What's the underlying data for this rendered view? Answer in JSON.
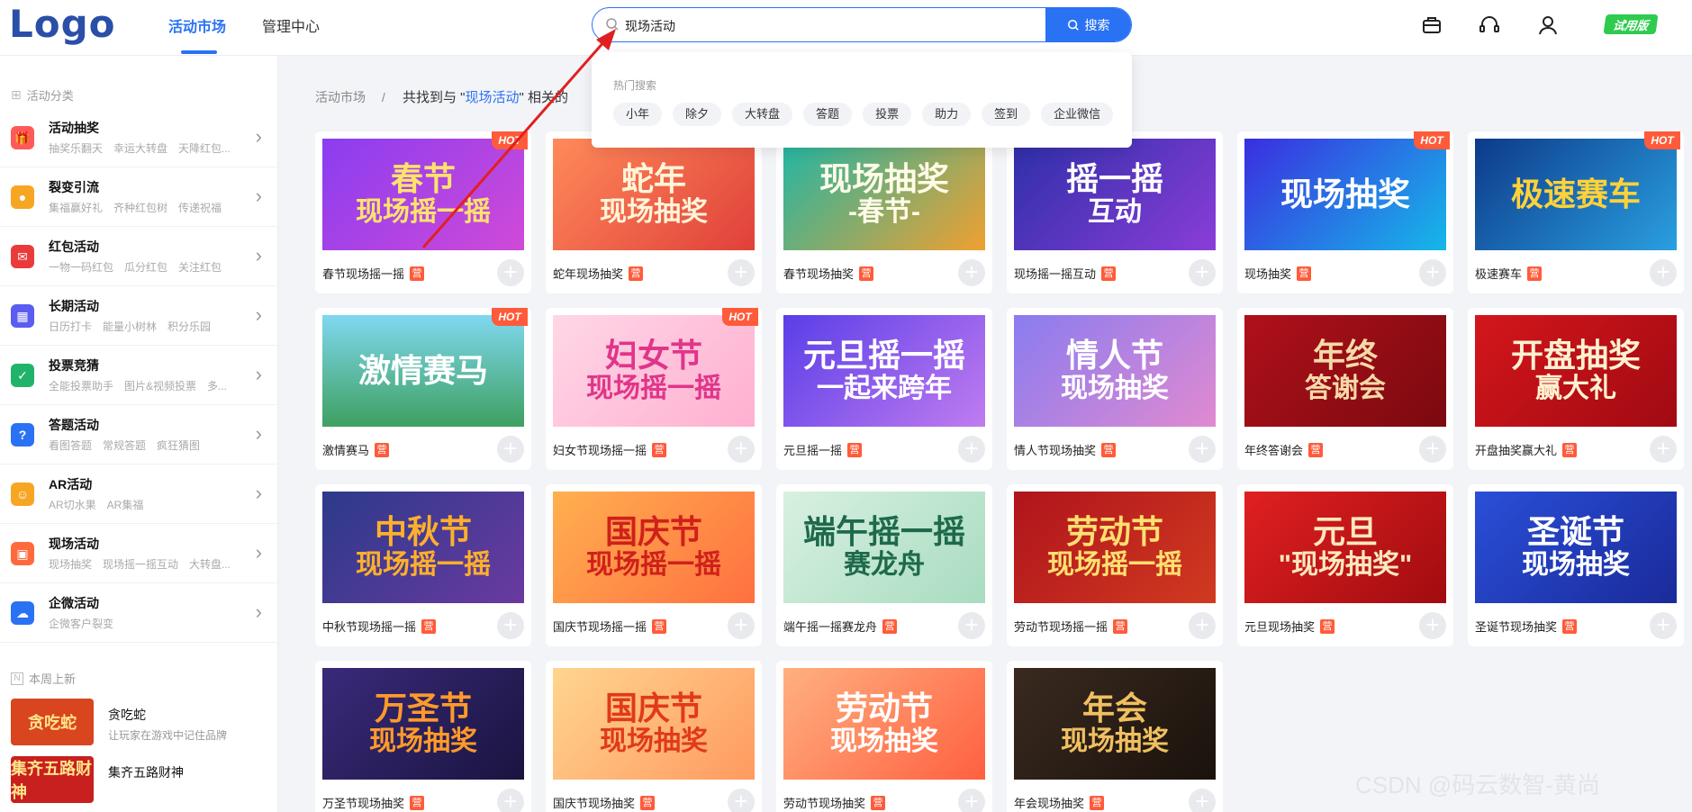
{
  "header": {
    "logo": "Logo",
    "nav": [
      {
        "label": "活动市场",
        "active": true
      },
      {
        "label": "管理中心",
        "active": false
      }
    ],
    "search": {
      "value": "现场活动",
      "button": "搜索"
    },
    "trial_label": "试用版",
    "icons": [
      "toolbox-icon",
      "headset-icon",
      "user-icon"
    ]
  },
  "sidebar": {
    "section_title": "活动分类",
    "categories": [
      {
        "title": "活动抽奖",
        "sub": "抽奖乐翻天　幸运大转盘　天降红包...",
        "icon": "gift-icon",
        "color": "#ff5a5a",
        "glyph": "🎁"
      },
      {
        "title": "裂变引流",
        "sub": "集福赢好礼　齐种红包树　传递祝福",
        "icon": "people-icon",
        "color": "#f7a623",
        "glyph": "●"
      },
      {
        "title": "红包活动",
        "sub": "一物一码红包　瓜分红包　关注红包",
        "icon": "red-envelope-icon",
        "color": "#ea3b3b",
        "glyph": "✉"
      },
      {
        "title": "长期活动",
        "sub": "日历打卡　能量小树林　积分乐园",
        "icon": "calendar-icon",
        "color": "#5b5cf0",
        "glyph": "▦"
      },
      {
        "title": "投票竞猜",
        "sub": "全能投票助手　图片&视频投票　多...",
        "icon": "vote-icon",
        "color": "#22b36b",
        "glyph": "✓"
      },
      {
        "title": "答题活动",
        "sub": "看图答题　常规答题　疯狂猜图",
        "icon": "question-icon",
        "color": "#2a72f4",
        "glyph": "?"
      },
      {
        "title": "AR活动",
        "sub": "AR切水果　AR集福",
        "icon": "robot-icon",
        "color": "#f7a623",
        "glyph": "☺"
      },
      {
        "title": "现场活动",
        "sub": "现场抽奖　现场摇一摇互动　大转盘...",
        "icon": "stage-icon",
        "color": "#ff6a3d",
        "glyph": "▣"
      },
      {
        "title": "企微活动",
        "sub": "企微客户裂变",
        "icon": "wecom-icon",
        "color": "#2a72f4",
        "glyph": "☁"
      }
    ],
    "new_title": "本周上新",
    "new_items": [
      {
        "title": "贪吃蛇",
        "sub": "让玩家在游戏中记住品牌",
        "thumb": "贪吃蛇",
        "color": "#d9451f"
      },
      {
        "title": "集齐五路财神",
        "sub": "",
        "thumb": "集齐五路财神",
        "color": "#c8201e"
      }
    ]
  },
  "breadcrumb": {
    "root": "活动市场",
    "separator": "/",
    "prefix": "共找到与 \"",
    "keyword": "现场活动",
    "suffix": "\" 相关的"
  },
  "dropdown": {
    "title": "热门搜索",
    "tags": [
      "小年",
      "除夕",
      "大转盘",
      "答题",
      "投票",
      "助力",
      "签到",
      "企业微信"
    ]
  },
  "badge_label": "营",
  "hot_label": "HOT",
  "cards": [
    {
      "name": "春节现场摇一摇",
      "line1": "春节",
      "line2": "现场摇一摇",
      "bg": "linear-gradient(135deg,#8a3df0,#d04ad8)",
      "fg": "#ffe36b",
      "hot": true
    },
    {
      "name": "蛇年现场抽奖",
      "line1": "蛇年",
      "line2": "现场抽奖",
      "bg": "linear-gradient(135deg,#ff8a5a,#e0403a)",
      "fg": "#fff5d8",
      "hot": false
    },
    {
      "name": "春节现场抽奖",
      "line1": "现场抽奖",
      "line2": "-春节-",
      "bg": "linear-gradient(135deg,#1fb6a6,#f0a030)",
      "fg": "#fffbe8",
      "hot": false
    },
    {
      "name": "现场摇一摇互动",
      "line1": "摇一摇",
      "line2": "互动",
      "bg": "linear-gradient(135deg,#2d2fa8,#8b3dd8)",
      "fg": "#ffffff",
      "hot": false
    },
    {
      "name": "现场抽奖",
      "line1": "现场抽奖",
      "line2": "",
      "bg": "linear-gradient(135deg,#3a2ee0,#16b8e8)",
      "fg": "#ffffff",
      "hot": true
    },
    {
      "name": "极速赛车",
      "line1": "极速赛车",
      "line2": "",
      "bg": "linear-gradient(135deg,#0d3a8a,#2aa0e0)",
      "fg": "#ffd23a",
      "hot": true
    },
    {
      "name": "激情赛马",
      "line1": "激情赛马",
      "line2": "",
      "bg": "linear-gradient(180deg,#7fd8f0,#3ea060)",
      "fg": "#ffffff",
      "hot": true
    },
    {
      "name": "妇女节现场摇一摇",
      "line1": "妇女节",
      "line2": "现场摇一摇",
      "bg": "linear-gradient(135deg,#ffd6e6,#ffb0d0)",
      "fg": "#e0358a",
      "hot": true
    },
    {
      "name": "元旦摇一摇",
      "line1": "元旦摇一摇",
      "line2": "一起来跨年",
      "bg": "linear-gradient(135deg,#5a3ee8,#c07cf0)",
      "fg": "#ffffff",
      "hot": false
    },
    {
      "name": "情人节现场抽奖",
      "line1": "情人节",
      "line2": "现场抽奖",
      "bg": "linear-gradient(135deg,#8a7cf0,#e08ad0)",
      "fg": "#ffffff",
      "hot": false
    },
    {
      "name": "年终答谢会",
      "line1": "年终",
      "line2": "答谢会",
      "bg": "linear-gradient(135deg,#b0101a,#7a0a10)",
      "fg": "#f5d9a8",
      "hot": false
    },
    {
      "name": "开盘抽奖赢大礼",
      "line1": "开盘抽奖",
      "line2": "赢大礼",
      "bg": "linear-gradient(135deg,#d4161c,#a00a12)",
      "fg": "#fff1d0",
      "hot": false
    },
    {
      "name": "中秋节现场摇一摇",
      "line1": "中秋节",
      "line2": "现场摇一摇",
      "bg": "linear-gradient(135deg,#2c3a8a,#6a3aa0)",
      "fg": "#ffb02a",
      "hot": false
    },
    {
      "name": "国庆节现场摇一摇",
      "line1": "国庆节",
      "line2": "现场摇一摇",
      "bg": "linear-gradient(135deg,#ffb050,#ff7040)",
      "fg": "#d0201a",
      "hot": false
    },
    {
      "name": "端午摇一摇赛龙舟",
      "line1": "端午摇一摇",
      "line2": "赛龙舟",
      "bg": "linear-gradient(135deg,#d8f0e0,#a8dcc0)",
      "fg": "#1e6a4a",
      "hot": false
    },
    {
      "name": "劳动节现场摇一摇",
      "line1": "劳动节",
      "line2": "现场摇一摇",
      "bg": "linear-gradient(135deg,#b0141c,#d03a20)",
      "fg": "#ffe070",
      "hot": false
    },
    {
      "name": "元旦现场抽奖",
      "line1": "元旦",
      "line2": "\"现场抽奖\"",
      "bg": "linear-gradient(135deg,#e02020,#a00c10)",
      "fg": "#ffe8c0",
      "hot": false
    },
    {
      "name": "圣诞节现场抽奖",
      "line1": "圣诞节",
      "line2": "现场抽奖",
      "bg": "linear-gradient(135deg,#2a4fd8,#1a2a9a)",
      "fg": "#ffffff",
      "hot": false
    },
    {
      "name": "万圣节现场抽奖",
      "line1": "万圣节",
      "line2": "现场抽奖",
      "bg": "linear-gradient(135deg,#3a2a7a,#1a1440)",
      "fg": "#ff9a2a",
      "hot": false
    },
    {
      "name": "国庆节现场抽奖",
      "line1": "国庆节",
      "line2": "现场抽奖",
      "bg": "linear-gradient(135deg,#ffd590,#ff9a60)",
      "fg": "#e03a1a",
      "hot": false
    },
    {
      "name": "劳动节现场抽奖",
      "line1": "劳动节",
      "line2": "现场抽奖",
      "bg": "linear-gradient(135deg,#ffb080,#ff6040)",
      "fg": "#ffffff",
      "hot": false
    },
    {
      "name": "年会现场抽奖",
      "line1": "年会",
      "line2": "现场抽奖",
      "bg": "linear-gradient(135deg,#3a2a20,#1a120c)",
      "fg": "#f0c060",
      "hot": false
    }
  ],
  "watermark": "CSDN @码云数智-黄尚",
  "colors": {
    "accent": "#2a72f4",
    "hot": "#ff5b3a",
    "trial": "#2ecb4f",
    "annotation_arrow": "#e02020"
  }
}
